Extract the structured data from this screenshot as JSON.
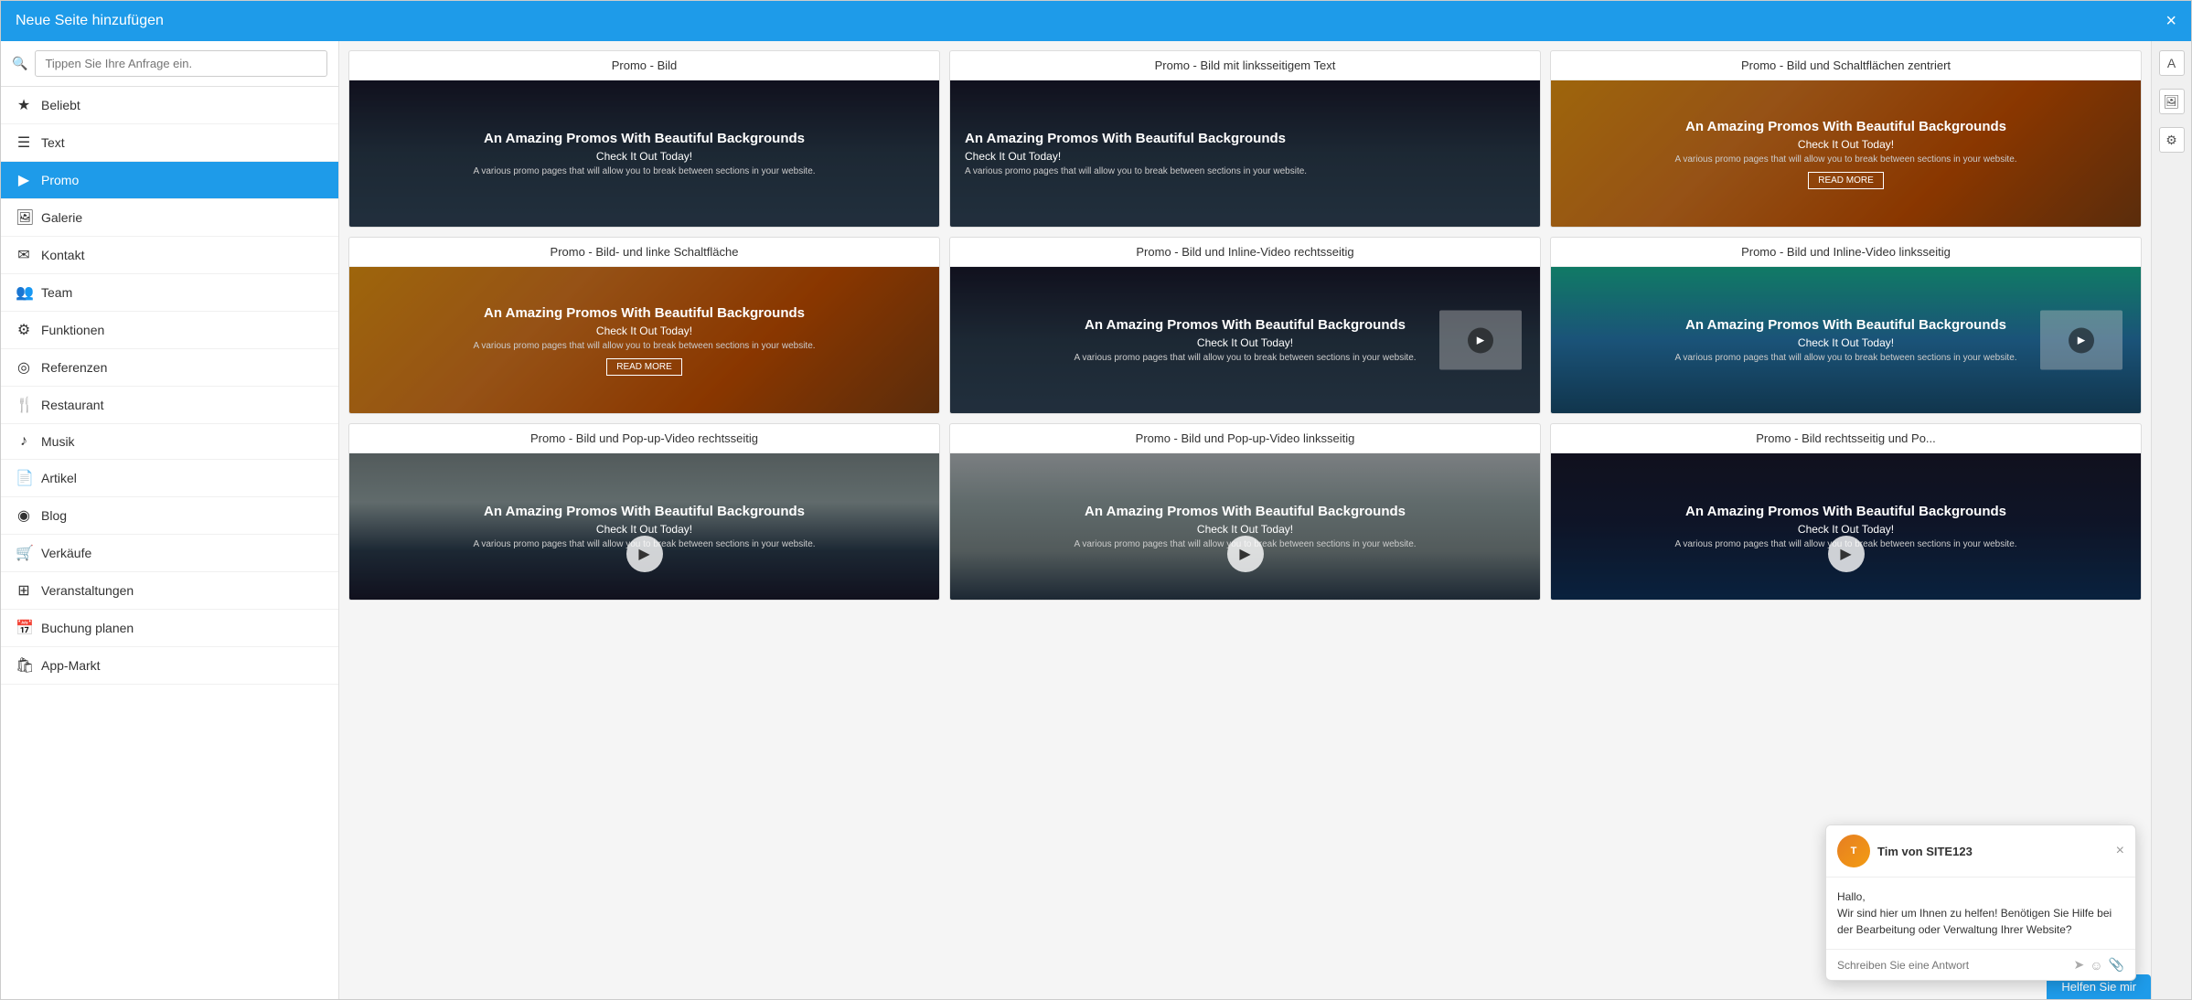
{
  "modal": {
    "title": "Neue Seite hinzufügen",
    "close_label": "×"
  },
  "search": {
    "placeholder": "Tippen Sie Ihre Anfrage ein."
  },
  "sidebar": {
    "items": [
      {
        "id": "beliebt",
        "icon": "★",
        "label": "Beliebt",
        "active": false
      },
      {
        "id": "text",
        "icon": "☰",
        "label": "Text",
        "active": false
      },
      {
        "id": "promo",
        "icon": "▶",
        "label": "Promo",
        "active": true
      },
      {
        "id": "galerie",
        "icon": "🖼",
        "label": "Galerie",
        "active": false
      },
      {
        "id": "kontakt",
        "icon": "✉",
        "label": "Kontakt",
        "active": false
      },
      {
        "id": "team",
        "icon": "👥",
        "label": "Team",
        "active": false
      },
      {
        "id": "funktionen",
        "icon": "⚙",
        "label": "Funktionen",
        "active": false
      },
      {
        "id": "referenzen",
        "icon": "◎",
        "label": "Referenzen",
        "active": false
      },
      {
        "id": "restaurant",
        "icon": "🍴",
        "label": "Restaurant",
        "active": false
      },
      {
        "id": "musik",
        "icon": "♪",
        "label": "Musik",
        "active": false
      },
      {
        "id": "artikel",
        "icon": "📄",
        "label": "Artikel",
        "active": false
      },
      {
        "id": "blog",
        "icon": "◉",
        "label": "Blog",
        "active": false
      },
      {
        "id": "verkaeufe",
        "icon": "🛒",
        "label": "Verkäufe",
        "active": false
      },
      {
        "id": "veranstaltungen",
        "icon": "⊞",
        "label": "Veranstaltungen",
        "active": false
      },
      {
        "id": "buchung",
        "icon": "📅",
        "label": "Buchung planen",
        "active": false
      },
      {
        "id": "appmarkt",
        "icon": "🛍",
        "label": "App-Markt",
        "active": false
      }
    ]
  },
  "grid": {
    "cards": [
      {
        "id": "promo-bild",
        "title": "Promo - Bild",
        "image_type": "city-dark",
        "overlay_title": "An Amazing Promos With Beautiful Backgrounds",
        "overlay_sub": "Check It Out Today!",
        "overlay_desc": "A various promo pages that will allow you to break between sections in your website."
      },
      {
        "id": "promo-bild-links",
        "title": "Promo - Bild mit linksseitigem Text",
        "image_type": "city-dark",
        "overlay_title": "An Amazing Promos With Beautiful Backgrounds",
        "overlay_sub": "Check It Out Today!",
        "overlay_desc": "A various promo pages that will allow you to break between sections in your website."
      },
      {
        "id": "promo-bild-schaltflaechen",
        "title": "Promo - Bild und Schaltflächen zentriert",
        "image_type": "sunset",
        "overlay_title": "An Amazing Promos With Beautiful Backgrounds",
        "overlay_sub": "Check It Out Today!",
        "overlay_desc": "A various promo pages that will allow you to break between sections in your website.",
        "has_button": true,
        "button_label": "READ MORE"
      },
      {
        "id": "promo-bild-schaltflaeche-links",
        "title": "Promo - Bild- und linke Schaltfläche",
        "image_type": "sunset",
        "overlay_title": "An Amazing Promos With Beautiful Backgrounds",
        "overlay_sub": "Check It Out Today!",
        "overlay_desc": "A various promo pages that will allow you to break between sections in your website.",
        "has_button": true,
        "button_label": "READ MORE"
      },
      {
        "id": "promo-bild-video-rechts",
        "title": "Promo - Bild und Inline-Video rechtsseitig",
        "image_type": "city-dark",
        "overlay_title": "An Amazing Promos With Beautiful Backgrounds",
        "overlay_sub": "Check It Out Today!",
        "overlay_desc": "A various promo pages that will allow you to break between sections in your website.",
        "has_video": true
      },
      {
        "id": "promo-bild-video-links",
        "title": "Promo - Bild und Inline-Video linksseitig",
        "image_type": "waterfall",
        "overlay_title": "An Amazing Promos With Beautiful Backgrounds",
        "overlay_sub": "Check It Out Today!",
        "overlay_desc": "A various promo pages that will allow you to break between sections in your website.",
        "has_video": true
      },
      {
        "id": "promo-bild-popup-rechts",
        "title": "Promo - Bild und Pop-up-Video rechtsseitig",
        "image_type": "city-fog",
        "overlay_title": "An Amazing Promos With Beautiful Backgrounds",
        "overlay_sub": "Check It Out Today!",
        "overlay_desc": "A various promo pages that will allow you to break between sections in your website.",
        "has_play_center": true
      },
      {
        "id": "promo-bild-popup-links",
        "title": "Promo - Bild und Pop-up-Video linksseitig",
        "image_type": "mountains",
        "overlay_title": "An Amazing Promos With Beautiful Backgrounds",
        "overlay_sub": "Check It Out Today!",
        "overlay_desc": "A various promo pages that will allow you to break between sections in your website.",
        "has_play_center": true
      },
      {
        "id": "promo-bild-rechts",
        "title": "Promo - Bild rechtsseitig und Po...",
        "image_type": "city-night",
        "overlay_title": "An Amazing Promos With Beautiful Backgrounds",
        "overlay_sub": "Check It Out Today!",
        "overlay_desc": "A various promo pages that will allow you to break between sections in your website.",
        "has_play_center": true,
        "partial": true
      }
    ]
  },
  "right_sidebar": {
    "icons": [
      "A",
      "🖼",
      "⚙"
    ]
  },
  "chat": {
    "agent_name": "Tim von SITE123",
    "agent_initials": "T",
    "message": "Hallo,\nWir sind hier um Ihnen zu helfen! Benötigen Sie Hilfe bei der Bearbeitung oder Verwaltung Ihrer Website?",
    "input_placeholder": "Schreiben Sie eine Antwort",
    "close_label": "×",
    "help_label": "Helfen Sie mir"
  }
}
